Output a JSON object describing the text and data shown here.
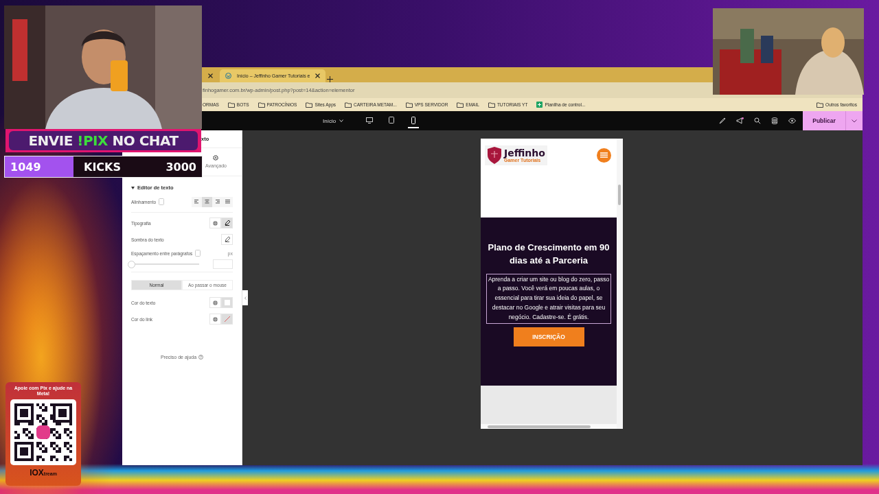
{
  "overlay": {
    "banner": {
      "before": "ENVIE",
      "highlight": "!PIX",
      "after": "NO CHAT"
    },
    "goal": {
      "count": "1049",
      "label": "KICKS",
      "target": "3000",
      "level": 0.35
    },
    "donation": {
      "title": "Apoie com Pix e ajude na Meta!",
      "brand_mark": "IOX",
      "brand_rest": "tream"
    }
  },
  "browser": {
    "tabs": [
      {
        "selected": false
      },
      {
        "title": "Início – Jeffinho Gamer Tutoriais e",
        "selected": true
      }
    ],
    "address": "finhogamer.com.br/wp-admin/post.php?post=14&action=elementor",
    "bookmarks": [
      {
        "label": "ORMAS",
        "kind": "cut"
      },
      {
        "label": "BOTS",
        "kind": "folder"
      },
      {
        "label": "PATROCÍNIOS",
        "kind": "folder"
      },
      {
        "label": "Sites Apps",
        "kind": "folder"
      },
      {
        "label": "CARTEIRA METAM...",
        "kind": "folder"
      },
      {
        "label": "VPS SERVIDOR",
        "kind": "folder"
      },
      {
        "label": "EMAIL",
        "kind": "folder"
      },
      {
        "label": "TUTORIAIS YT",
        "kind": "folder"
      },
      {
        "label": "Planilha de control...",
        "kind": "sheet"
      }
    ],
    "other_bookmarks": "Outros favoritos"
  },
  "topbar": {
    "page": "Início",
    "devices": [
      {
        "kind": "desktop",
        "selected": false
      },
      {
        "kind": "tablet",
        "selected": false
      },
      {
        "kind": "mobile",
        "selected": true
      }
    ],
    "publish": "Publicar"
  },
  "panel": {
    "title": "xto",
    "tab": {
      "label": "Avançado",
      "selected": false
    },
    "section": "Editor de texto",
    "alignment": {
      "label": "Alinhamento",
      "options": [
        {
          "kind": "left",
          "selected": false
        },
        {
          "kind": "center",
          "selected": true
        },
        {
          "kind": "right",
          "selected": false
        },
        {
          "kind": "justify",
          "selected": false
        }
      ]
    },
    "typography": {
      "label": "Tipografia",
      "editing": true
    },
    "shadow": {
      "label": "Sombra do texto"
    },
    "spacing": {
      "label": "Espaçamento entre parágrafos",
      "unit": "px",
      "level": 0
    },
    "states": [
      {
        "label": "Normal",
        "selected": true
      },
      {
        "label": "Ao passar o mouse",
        "selected": false
      }
    ],
    "colors": [
      {
        "label": "Cor do texto",
        "kind": "empty"
      },
      {
        "label": "Cor do link",
        "kind": "unset"
      }
    ],
    "help": "Preciso de ajuda"
  },
  "preview": {
    "logo_name": "Jeffinho",
    "logo_tagline": "Gamer Tutoriais",
    "heading": "Plano de Crescimento em 90 dias até a Parceria",
    "body": "Aprenda a criar um site ou blog do zero, passo a passo. Você verá em poucas aulas, o essencial para tirar sua ideia do papel, se destacar no Google e atrair visitas para seu negócio. Cadastre-se. É grátis.",
    "button": "INSCRIÇÃO"
  }
}
